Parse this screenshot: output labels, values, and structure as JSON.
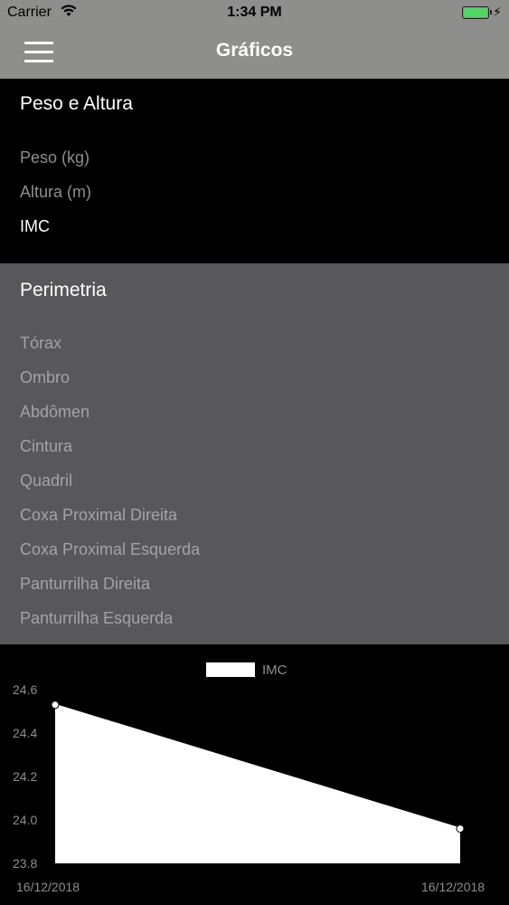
{
  "status_bar": {
    "carrier": "Carrier",
    "time": "1:34 PM",
    "icons": [
      "wifi-icon",
      "battery-icon",
      "charging-bolt-icon"
    ],
    "battery_color": "#4cd964"
  },
  "nav": {
    "title": "Gráficos",
    "menu_icon": "hamburger-menu-icon",
    "background": "#8e8e8c"
  },
  "section_peso": {
    "title": "Peso e Altura",
    "items": [
      "Peso (kg)",
      "Altura (m)",
      "IMC"
    ],
    "selected": "IMC"
  },
  "section_perimetria": {
    "title": "Perimetria",
    "items": [
      "Tórax",
      "Ombro",
      "Abdômen",
      "Cintura",
      "Quadril",
      "Coxa Proximal Direita",
      "Coxa Proximal Esquerda",
      "Panturrilha Direita",
      "Panturrilha Esquerda"
    ]
  },
  "chart_data": {
    "type": "area",
    "series": [
      {
        "name": "IMC",
        "values": [
          24.53,
          23.96
        ]
      }
    ],
    "x": [
      "16/12/2018",
      "16/12/2018"
    ],
    "xlabels": [
      "16/12/2018",
      "16/12/2018"
    ],
    "yticks": [
      "24.6",
      "24.4",
      "24.2",
      "24.0",
      "23.8"
    ],
    "ylim": [
      23.8,
      24.6
    ],
    "legend": "top-center",
    "grid": false,
    "fill_color": "#ffffff",
    "label_color": "#8e8e8e"
  }
}
